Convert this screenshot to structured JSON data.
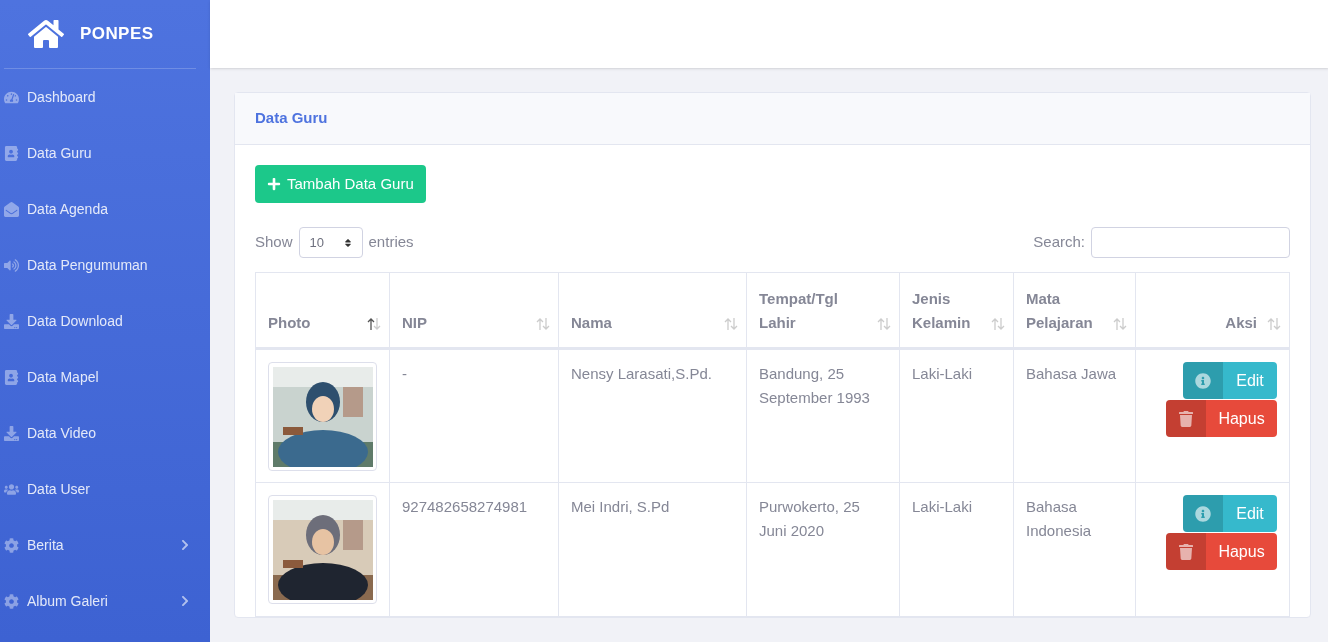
{
  "brand": {
    "title": "PONPES"
  },
  "sidebar": {
    "items": [
      {
        "label": "Dashboard",
        "has_submenu": false
      },
      {
        "label": "Data Guru",
        "has_submenu": false
      },
      {
        "label": "Data Agenda",
        "has_submenu": false
      },
      {
        "label": "Data Pengumuman",
        "has_submenu": false
      },
      {
        "label": "Data Download",
        "has_submenu": false
      },
      {
        "label": "Data Mapel",
        "has_submenu": false
      },
      {
        "label": "Data Video",
        "has_submenu": false
      },
      {
        "label": "Data User",
        "has_submenu": false
      },
      {
        "label": "Berita",
        "has_submenu": true
      },
      {
        "label": "Album Galeri",
        "has_submenu": true
      }
    ]
  },
  "card": {
    "title": "Data Guru",
    "add_button": "Tambah Data Guru",
    "show_label": "Show",
    "entries_value": "10",
    "entries_label": "entries",
    "search_label": "Search:",
    "table": {
      "columns": [
        {
          "label": "Photo",
          "sorted": true
        },
        {
          "label": "NIP",
          "sorted": false
        },
        {
          "label": "Nama",
          "sorted": false
        },
        {
          "label": "Tempat/Tgl Lahir",
          "sorted": false
        },
        {
          "label": "Jenis Kelamin",
          "sorted": false
        },
        {
          "label": "Mata Pelajaran",
          "sorted": false
        },
        {
          "label": "Aksi",
          "sorted": false
        }
      ],
      "rows": [
        {
          "nip": "-",
          "nama": "Nensy Larasati,S.Pd.",
          "ttl": "Bandung, 25 September 1993",
          "jk": "Laki-Laki",
          "mapel": "Bahasa Jawa",
          "edit": "Edit",
          "hapus": "Hapus"
        },
        {
          "nip": "927482658274981",
          "nama": "Mei Indri, S.Pd",
          "ttl": "Purwokerto, 25 Juni 2020",
          "jk": "Laki-Laki",
          "mapel": "Bahasa Indonesia",
          "edit": "Edit",
          "hapus": "Hapus"
        }
      ]
    }
  }
}
